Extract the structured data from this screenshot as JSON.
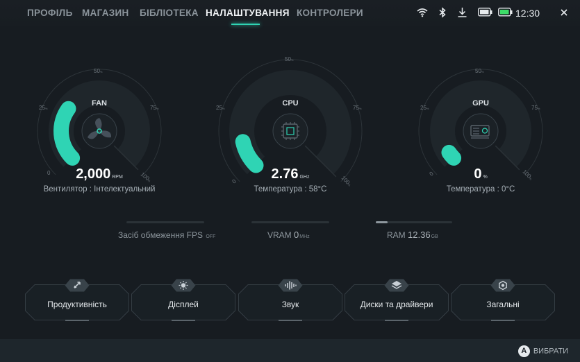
{
  "nav": {
    "tabs": [
      {
        "label": "ПРОФІЛЬ"
      },
      {
        "label": "МАГАЗИН"
      },
      {
        "label": "БІБЛІОТЕКА"
      },
      {
        "label": "НАЛАШТУВАННЯ"
      },
      {
        "label": "КОНТРОЛЕРИ"
      }
    ],
    "active_tab": "НАЛАШТУВАННЯ"
  },
  "status": {
    "time": "12:30",
    "icons": [
      "wifi-icon",
      "bluetooth-icon",
      "download-icon",
      "controller-battery-icon",
      "battery-icon",
      "close-icon"
    ],
    "battery_color": "#3ddc68"
  },
  "gauges": {
    "fan": {
      "title": "FAN",
      "value": "2,000",
      "unit": "RPM",
      "subtitle": "Вентилятор : Інтелектуальний",
      "level": 0.3,
      "icon": "fan-icon"
    },
    "cpu": {
      "title": "CPU",
      "value": "2.76",
      "unit": "GHz",
      "subtitle": "Температура : 58°C",
      "level": 0.12,
      "icon": "cpu-icon"
    },
    "gpu": {
      "title": "GPU",
      "value": "0",
      "unit": "%",
      "subtitle": "Температура : 0°C",
      "level": 0.04,
      "icon": "gpu-icon"
    },
    "ticks": {
      "t0": "0",
      "t25": "25",
      "t25u": "%",
      "t50": "50",
      "t50u": "%",
      "t75": "75",
      "t75u": "%",
      "t100": "100",
      "t100u": "%"
    }
  },
  "meters": {
    "fps": {
      "label": "Засіб обмеження FPS",
      "value": "",
      "unit": "OFF",
      "level": 0
    },
    "vram": {
      "label": "VRAM",
      "value": "0",
      "unit": "MHz",
      "level": 0
    },
    "ram": {
      "label": "RAM",
      "value": "12.36",
      "unit": "GB",
      "level": 0.15
    }
  },
  "categories": [
    {
      "label": "Продуктивність",
      "icon": "rocket-icon"
    },
    {
      "label": "Дісплей",
      "icon": "brightness-icon"
    },
    {
      "label": "Звук",
      "icon": "sound-wave-icon"
    },
    {
      "label": "Диски та драйвери",
      "icon": "layers-icon"
    },
    {
      "label": "Загальні",
      "icon": "settings-icon"
    }
  ],
  "footer": {
    "button": "A",
    "action": "ВИБРАТИ"
  },
  "colors": {
    "accent": "#2fd4b4",
    "background": "#171c21"
  }
}
